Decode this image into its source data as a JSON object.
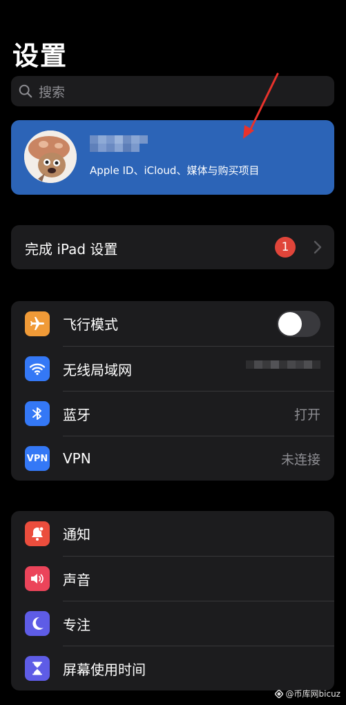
{
  "header": {
    "title": "设置"
  },
  "search": {
    "placeholder": "搜索"
  },
  "account": {
    "subtitle": "Apple ID、iCloud、媒体与购买项目"
  },
  "setup": {
    "label": "完成 iPad 设置",
    "badge": "1"
  },
  "connectivity": [
    {
      "label": "飞行模式",
      "icon": "airplane-icon",
      "color": "#f09a37",
      "toggle_on": false
    },
    {
      "label": "无线局域网",
      "icon": "wifi-icon",
      "color": "#3478f6"
    },
    {
      "label": "蓝牙",
      "icon": "bluetooth-icon",
      "color": "#3478f6",
      "value": "打开"
    },
    {
      "label": "VPN",
      "icon": "vpn-icon",
      "color": "#3478f6",
      "value": "未连接"
    }
  ],
  "notifications": [
    {
      "label": "通知",
      "icon": "bell-icon",
      "color": "#eb4d3d"
    },
    {
      "label": "声音",
      "icon": "speaker-icon",
      "color": "#eb445a"
    },
    {
      "label": "专注",
      "icon": "moon-icon",
      "color": "#5e5ce6"
    },
    {
      "label": "屏幕使用时间",
      "icon": "hourglass-icon",
      "color": "#5e5ce6"
    }
  ],
  "watermark": {
    "text": "@币库网bicuz"
  },
  "colors": {
    "accent_blue": "#2c64b7",
    "cell_bg": "#1c1c1e",
    "badge_red": "#e0453a"
  }
}
